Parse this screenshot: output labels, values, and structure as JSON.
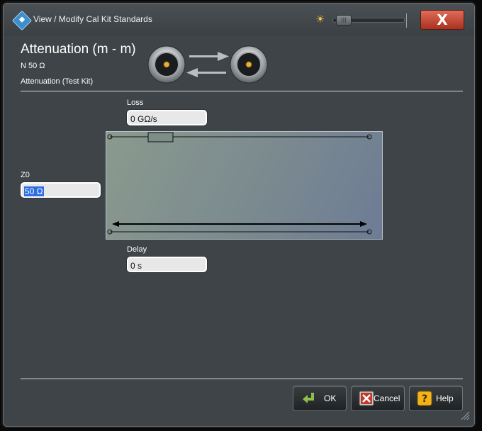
{
  "window": {
    "title": "View / Modify Cal Kit Standards",
    "close_label": "X"
  },
  "header": {
    "title": "Attenuation (m - m)",
    "connector": "N 50 Ω",
    "standard": "Attenuation (Test Kit)"
  },
  "fields": {
    "loss": {
      "label": "Loss",
      "value": "0 GΩ/s"
    },
    "z0": {
      "label": "Z0",
      "value": "50 Ω"
    },
    "delay": {
      "label": "Delay",
      "value": "0 s"
    }
  },
  "buttons": {
    "ok": "OK",
    "cancel": "Cancel",
    "help": "Help"
  },
  "icons": {
    "app": "rs-logo-icon",
    "brightness": "sun-icon",
    "close": "close-icon",
    "ok": "enter-arrow-icon",
    "cancel": "cancel-x-icon",
    "help": "help-question-icon"
  },
  "colors": {
    "close_button": "#c94b36",
    "selection": "#2e6ee0",
    "diagram_bg": "#7b8a8f"
  }
}
